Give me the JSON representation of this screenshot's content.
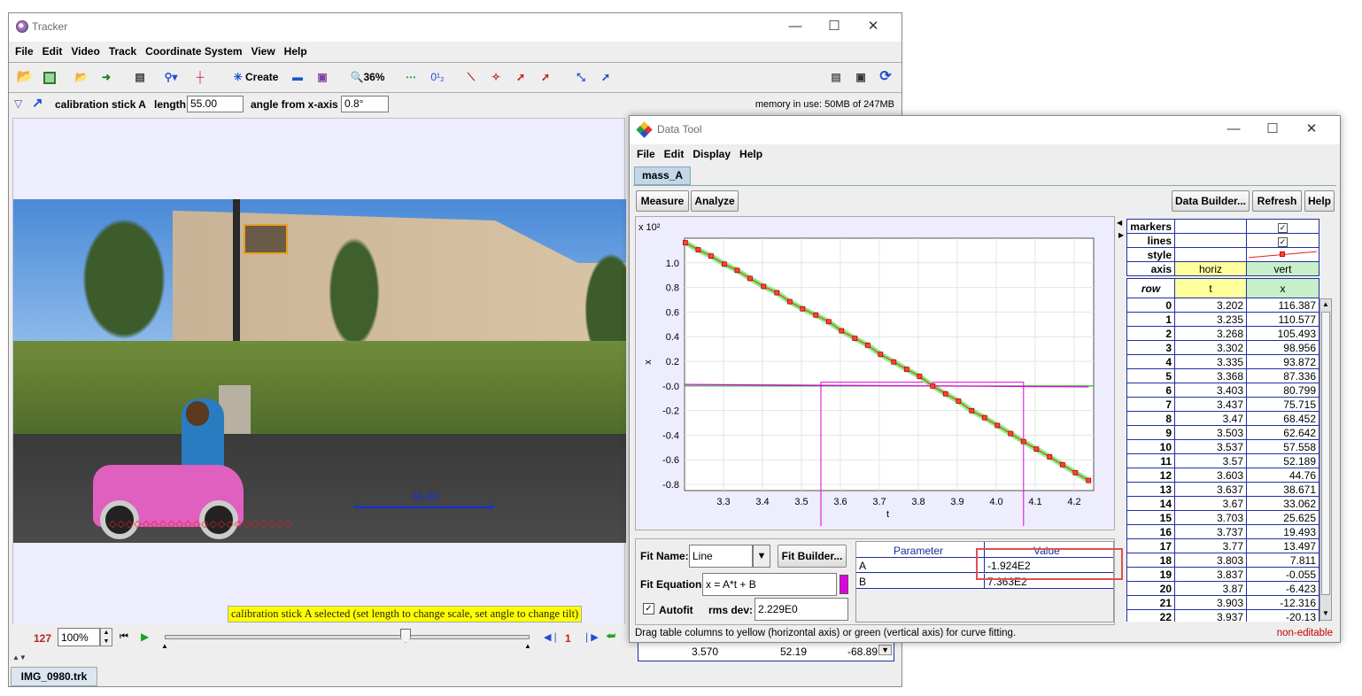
{
  "tracker": {
    "title": "Tracker",
    "menu": [
      "File",
      "Edit",
      "Video",
      "Track",
      "Coordinate System",
      "View",
      "Help"
    ],
    "toolbar": {
      "create_label": "Create",
      "zoom_label": "36%",
      "dataset_label": "0¹₂"
    },
    "track_bar": {
      "track_name": "calibration stick A",
      "length_label": "length",
      "length_value": "55.00",
      "angle_label": "angle from x-axis",
      "angle_value": "0.8°",
      "memory": "memory in use: 50MB of 247MB"
    },
    "video": {
      "stick_label": "55.00",
      "status_msg": "calibration stick A selected (set length to change scale, set angle to change tilt)"
    },
    "player": {
      "frame": "127",
      "zoom": "100%",
      "step": "1",
      "slider_fraction": 0.66
    },
    "file_tab": "IMG_0980.trk",
    "hidden_row": {
      "t": "3.570",
      "x": "52.19",
      "y": "-68.89"
    }
  },
  "datatool": {
    "title": "Data Tool",
    "menu": [
      "File",
      "Edit",
      "Display",
      "Help"
    ],
    "tab": "mass_A",
    "buttons": {
      "measure": "Measure",
      "analyze": "Analyze",
      "data_builder": "Data Builder...",
      "refresh": "Refresh",
      "help": "Help"
    },
    "plot": {
      "y_exp": "x 10²",
      "xlabel": "t",
      "ylabel": "x"
    },
    "chart_data": {
      "type": "scatter",
      "xlabel": "t",
      "ylabel": "x",
      "y_scale_label": "x 10²",
      "xlim": [
        3.2,
        4.25
      ],
      "ylim": [
        -0.85,
        1.2
      ],
      "x_ticks": [
        "3.3",
        "3.4",
        "3.5",
        "3.6",
        "3.7",
        "3.8",
        "3.9",
        "4.0",
        "4.1",
        "4.2"
      ],
      "y_ticks": [
        "1.0",
        "0.8",
        "0.6",
        "0.4",
        "0.2",
        "-0.0",
        "-0.2",
        "-0.4",
        "-0.6",
        "-0.8"
      ],
      "series": [
        {
          "values_t": [
            3.202,
            3.235,
            3.268,
            3.302,
            3.335,
            3.368,
            3.403,
            3.437,
            3.47,
            3.503,
            3.537,
            3.57,
            3.603,
            3.637,
            3.67,
            3.703,
            3.737,
            3.77,
            3.803,
            3.837,
            3.87,
            3.903,
            3.937,
            3.97,
            4.003,
            4.037,
            4.07,
            4.103,
            4.137,
            4.17,
            4.203,
            4.237
          ],
          "values_x": [
            1.16387,
            1.10577,
            1.05493,
            0.98956,
            0.93872,
            0.87336,
            0.80799,
            0.75715,
            0.68452,
            0.62642,
            0.57558,
            0.52189,
            0.4476,
            0.38671,
            0.33062,
            0.25625,
            0.19493,
            0.13497,
            0.07811,
            -0.00055,
            -0.06423,
            -0.12316,
            -0.2013,
            -0.258,
            -0.321,
            -0.387,
            -0.452,
            -0.513,
            -0.576,
            -0.64,
            -0.705,
            -0.768
          ]
        }
      ],
      "fit": {
        "A": -1.924,
        "B": 7.363
      },
      "color_data": "#ff2020",
      "color_fit": "#e000e0",
      "color_zero": "#00aa00"
    },
    "fit": {
      "name_label": "Fit Name:",
      "name_value": "Line",
      "builder_label": "Fit Builder...",
      "equation_label": "Fit Equation:",
      "equation_value": "x = A*t + B",
      "autofit_label": "Autofit",
      "rms_label": "rms dev:",
      "rms_value": "2.229E0",
      "param_header": "Parameter",
      "value_header": "Value",
      "params": [
        {
          "name": "A",
          "value": "-1.924E2"
        },
        {
          "name": "B",
          "value": "7.363E2"
        }
      ]
    },
    "props": {
      "rows": [
        {
          "label": "markers",
          "col1": "",
          "col2": "✓"
        },
        {
          "label": "lines",
          "col1": "",
          "col2": "✓"
        },
        {
          "label": "style",
          "col1": "",
          "col2": ""
        },
        {
          "label": "axis",
          "col1": "horiz",
          "col2": "vert"
        }
      ]
    },
    "table": {
      "headers": [
        "row",
        "t",
        "x"
      ],
      "rows": [
        [
          "0",
          "3.202",
          "116.387"
        ],
        [
          "1",
          "3.235",
          "110.577"
        ],
        [
          "2",
          "3.268",
          "105.493"
        ],
        [
          "3",
          "3.302",
          "98.956"
        ],
        [
          "4",
          "3.335",
          "93.872"
        ],
        [
          "5",
          "3.368",
          "87.336"
        ],
        [
          "6",
          "3.403",
          "80.799"
        ],
        [
          "7",
          "3.437",
          "75.715"
        ],
        [
          "8",
          "3.47",
          "68.452"
        ],
        [
          "9",
          "3.503",
          "62.642"
        ],
        [
          "10",
          "3.537",
          "57.558"
        ],
        [
          "11",
          "3.57",
          "52.189"
        ],
        [
          "12",
          "3.603",
          "44.76"
        ],
        [
          "13",
          "3.637",
          "38.671"
        ],
        [
          "14",
          "3.67",
          "33.062"
        ],
        [
          "15",
          "3.703",
          "25.625"
        ],
        [
          "16",
          "3.737",
          "19.493"
        ],
        [
          "17",
          "3.77",
          "13.497"
        ],
        [
          "18",
          "3.803",
          "7.811"
        ],
        [
          "19",
          "3.837",
          "-0.055"
        ],
        [
          "20",
          "3.87",
          "-6.423"
        ],
        [
          "21",
          "3.903",
          "-12.316"
        ],
        [
          "22",
          "3.937",
          "-20.13"
        ]
      ]
    },
    "status": "Drag table columns to yellow (horizontal axis) or green (vertical axis) for curve fitting.",
    "non_editable": "non-editable"
  }
}
